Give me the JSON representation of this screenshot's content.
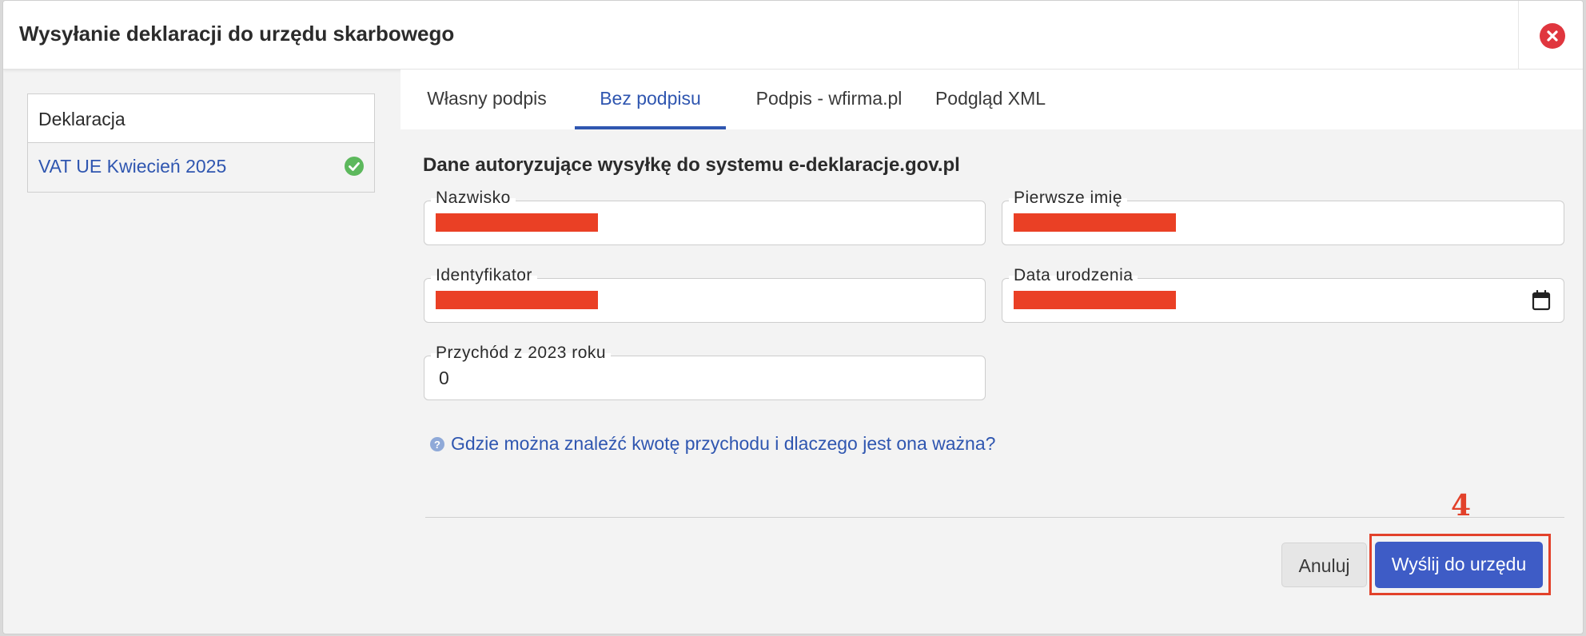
{
  "dialog": {
    "title": "Wysyłanie deklaracji do urzędu skarbowego",
    "close_icon": "close-circle-icon"
  },
  "sidebar": {
    "header": "Deklaracja",
    "items": [
      {
        "label": "VAT UE Kwiecień 2025",
        "status_icon": "check-circle-icon",
        "status_color": "#5cb85c"
      }
    ]
  },
  "tabs": [
    {
      "label": "Własny podpis",
      "active": false
    },
    {
      "label": "Bez podpisu",
      "active": true
    },
    {
      "label": "Podpis - wfirma.pl",
      "active": false
    },
    {
      "label": "Podgląd XML",
      "active": false
    }
  ],
  "form": {
    "section_title": "Dane autoryzujące wysyłkę do systemu e-deklaracje.gov.pl",
    "fields": {
      "surname": {
        "label": "Nazwisko",
        "value": "",
        "redacted": true
      },
      "first_name": {
        "label": "Pierwsze imię",
        "value": "",
        "redacted": true
      },
      "identifier": {
        "label": "Identyfikator",
        "value": "",
        "redacted": true
      },
      "birth_date": {
        "label": "Data urodzenia",
        "value": "",
        "redacted": true,
        "icon": "calendar-icon"
      },
      "income": {
        "label": "Przychód z 2023 roku",
        "value": "0"
      }
    },
    "help_link": "Gdzie można znaleźć kwotę przychodu i dlaczego jest ona ważna?"
  },
  "actions": {
    "cancel_label": "Anuluj",
    "send_label": "Wyślij do urzędu"
  },
  "annotation": {
    "marker": "4",
    "color": "#e2412a"
  },
  "colors": {
    "accent": "#2f56b0",
    "primary_button": "#3e5cc6",
    "redaction": "#ea4025",
    "close": "#e0363e"
  }
}
